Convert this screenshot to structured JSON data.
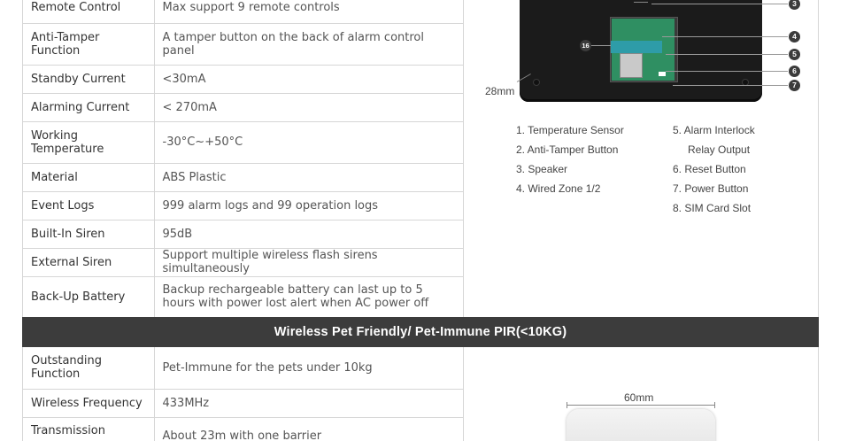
{
  "spec_rows_top": [
    {
      "label": "Remote Control",
      "value": "Max support 9 remote controls"
    },
    {
      "label": "Anti-Tamper Function",
      "value": "A tamper button on the back of alarm control panel"
    },
    {
      "label": "Standby Current",
      "value": "<30mA"
    },
    {
      "label": "Alarming Current",
      "value": "< 270mA"
    },
    {
      "label": "Working Temperature",
      "value": "-30°C~+50°C"
    },
    {
      "label": "Material",
      "value": "ABS Plastic"
    },
    {
      "label": "Event Logs",
      "value": "999 alarm logs and 99 operation logs"
    },
    {
      "label": "Built-In Siren",
      "value": "95dB"
    },
    {
      "label": "External Siren",
      "value": "Support multiple wireless flash sirens simultaneously"
    },
    {
      "label": "Back-Up Battery",
      "value": "Backup rechargeable battery can last up to 5 hours with power lost alert when AC power off"
    }
  ],
  "section_banner": "Wireless Pet Friendly/ Pet-Immune PIR(<10KG)",
  "spec_rows_bottom": [
    {
      "label": "Outstanding Function",
      "value": "Pet-Immune for the pets under 10kg"
    },
    {
      "label": "Wireless Frequency",
      "value": "433MHz"
    },
    {
      "label": "Transmission",
      "value": "About 23m with one barrier"
    }
  ],
  "panel_figure": {
    "callouts": [
      "3",
      "4",
      "5",
      "6",
      "7"
    ],
    "callout_16": "16",
    "depth_label": "28mm"
  },
  "panel_legend": {
    "left": [
      "1. Temperature Sensor",
      "2. Anti-Tamper Button",
      "3. Speaker",
      "4. Wired Zone 1/2"
    ],
    "right": [
      "5. Alarm Interlock",
      "Relay Output",
      "6. Reset Button",
      "7. Power Button",
      "8. SIM Card Slot"
    ]
  },
  "pir_figure": {
    "width_label": "60mm"
  }
}
